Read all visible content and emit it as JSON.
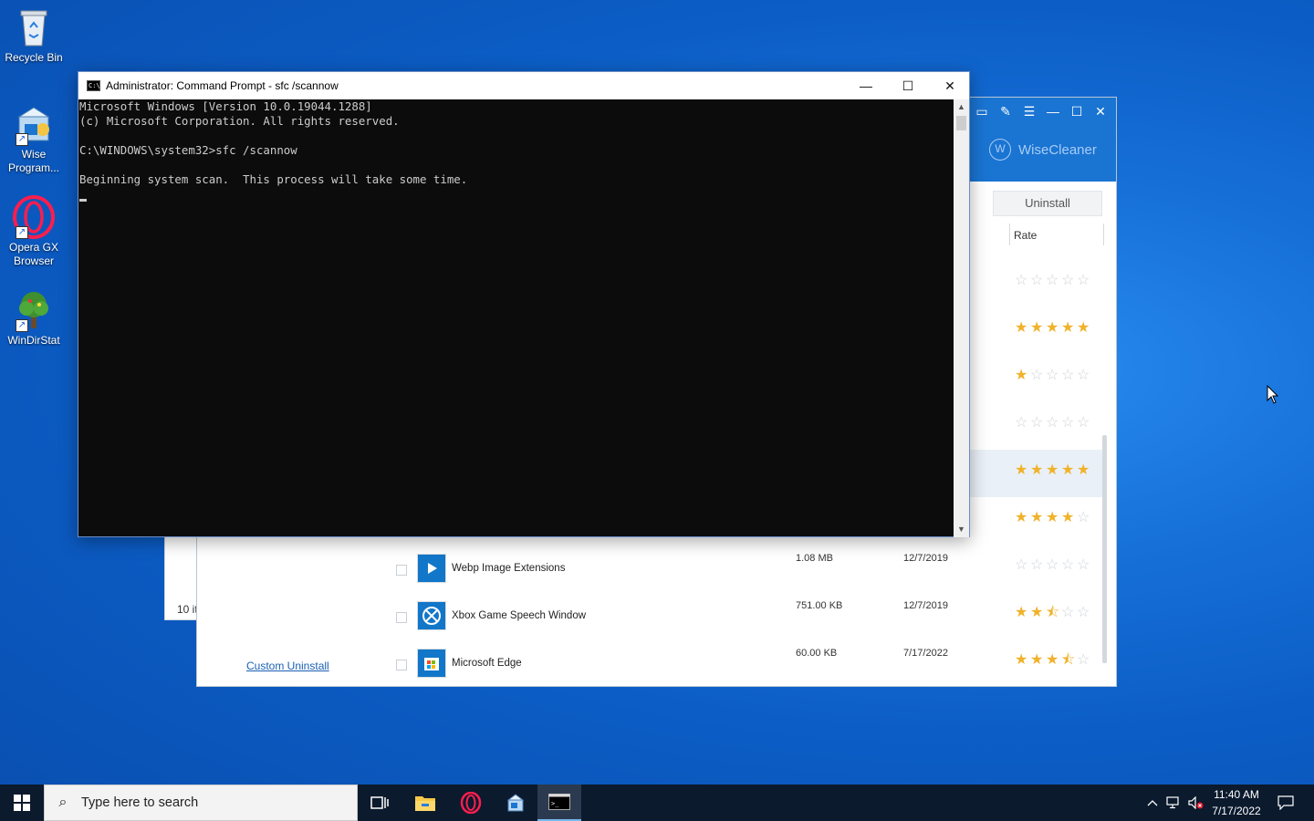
{
  "desktop": {
    "icons": [
      {
        "label": "Recycle Bin",
        "icon": "recycle-bin-icon"
      },
      {
        "label": "Wise Program...",
        "icon": "wise-program-uninstaller-icon"
      },
      {
        "label": "Opera GX Browser",
        "icon": "opera-gx-icon"
      },
      {
        "label": "WinDirStat",
        "icon": "windirstat-icon"
      }
    ]
  },
  "wise": {
    "brand": "WiseCleaner",
    "logo_letter": "W",
    "uninstall_label": "Uninstall",
    "rate_header": "Rate",
    "custom_uninstall": "Custom Uninstall",
    "items_count_partial": "10 it",
    "accent": "#1a74d2",
    "star_color": "#f0b22a",
    "ratings": [
      0,
      5,
      1,
      0,
      5,
      4
    ],
    "rows": [
      {
        "name": "Webp Image Extensions",
        "size": "1.08 MB",
        "date": "12/7/2019",
        "rating": 0,
        "icon": "webp-extension-icon"
      },
      {
        "name": "Xbox Game Speech Window",
        "size": "751.00 KB",
        "date": "12/7/2019",
        "rating": 2.5,
        "icon": "xbox-icon"
      },
      {
        "name": "Microsoft Edge",
        "size": "60.00 KB",
        "date": "7/17/2022",
        "rating": 3.5,
        "icon": "edge-store-icon"
      }
    ]
  },
  "cmd": {
    "title": "Administrator: Command Prompt - sfc  /scannow",
    "icon_text": "C:\\",
    "lines": [
      "Microsoft Windows [Version 10.0.19044.1288]",
      "(c) Microsoft Corporation. All rights reserved.",
      "",
      "C:\\WINDOWS\\system32>sfc /scannow",
      "",
      "Beginning system scan.  This process will take some time.",
      ""
    ]
  },
  "taskbar": {
    "search_placeholder": "Type here to search",
    "apps": [
      "task-view-icon",
      "file-explorer-icon",
      "opera-gx-icon",
      "wise-program-uninstaller-icon",
      "command-prompt-icon"
    ],
    "active_app": "command-prompt-icon",
    "tray_icons": [
      "chevron-up-icon",
      "network-icon",
      "volume-muted-icon"
    ],
    "time": "11:40 AM",
    "date": "7/17/2022"
  }
}
